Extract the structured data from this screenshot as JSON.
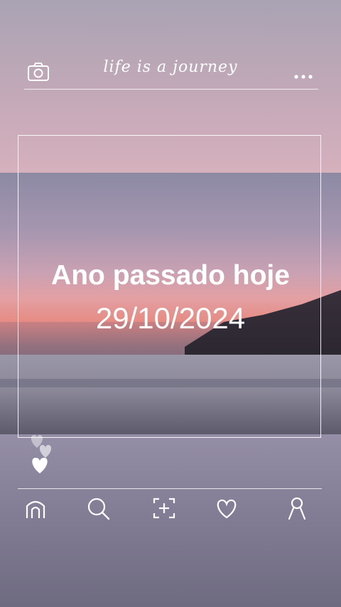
{
  "header": {
    "tagline": "life is a journey"
  },
  "main": {
    "title": "Ano passado hoje",
    "date": "29/10/2024"
  },
  "icons": {
    "camera": "camera-icon",
    "more": "more-dots-icon",
    "hearts": "heart-icon",
    "home": "home-icon",
    "search": "search-icon",
    "add": "add-icon",
    "like": "heart-icon",
    "profile": "profile-icon"
  },
  "colors": {
    "foreground": "#ffffff"
  }
}
